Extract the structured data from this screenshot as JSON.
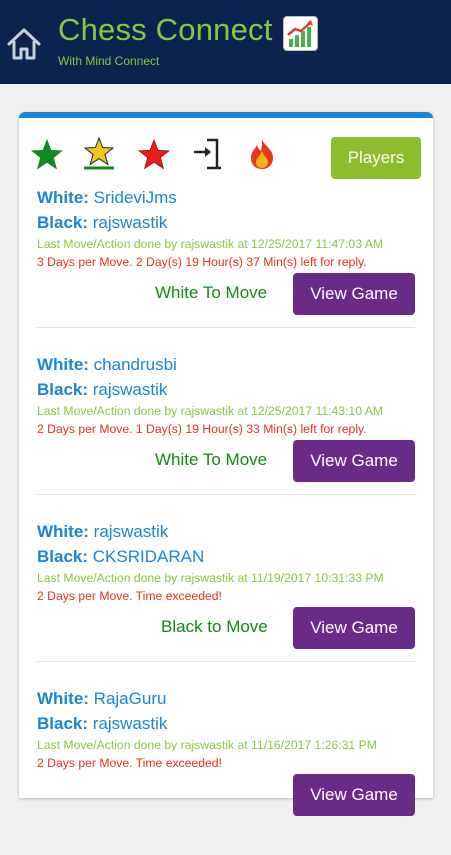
{
  "app": {
    "title": "Chess Connect",
    "subtitle": "With Mind Connect"
  },
  "toolbar": {
    "icons": [
      "star-icon",
      "star-outline-badge-icon",
      "red-star-icon",
      "exit-icon",
      "fire-icon"
    ],
    "players_label": "Players"
  },
  "labels": {
    "white": "White:",
    "black": "Black:",
    "view_game": "View Game"
  },
  "games": [
    {
      "white": "SrideviJms",
      "black": "rajswastik",
      "last_move": "Last Move/Action done by rajswastik at 12/25/2017 11:47:03 AM",
      "time_info": "3 Days per Move. 2 Day(s) 19 Hour(s) 37 Min(s) left for reply.",
      "status": "White To Move"
    },
    {
      "white": "chandrusbi",
      "black": "rajswastik",
      "last_move": "Last Move/Action done by rajswastik at 12/25/2017 11:43:10 AM",
      "time_info": "2 Days per Move. 1 Day(s) 19 Hour(s) 33 Min(s) left for reply.",
      "status": "White To Move"
    },
    {
      "white": "rajswastik",
      "black": "CKSRIDARAN",
      "last_move": "Last Move/Action done by rajswastik at 11/19/2017 10:31:33 PM",
      "time_info": "2 Days per Move. Time exceeded!",
      "status": "Black to Move"
    },
    {
      "white": "RajaGuru",
      "black": "rajswastik",
      "last_move": "Last Move/Action done by rajswastik at 11/16/2017 1:26:31 PM",
      "time_info": "2 Days per Move. Time exceeded!",
      "status": ""
    }
  ],
  "colors": {
    "header_bg": "#0c2350",
    "accent_green": "#8cc63f",
    "link_blue": "#1a85d6",
    "status_green": "#138a13",
    "alert_red": "#e8321a",
    "button_purple": "#6a2a88",
    "players_green": "#8dbd2f"
  }
}
